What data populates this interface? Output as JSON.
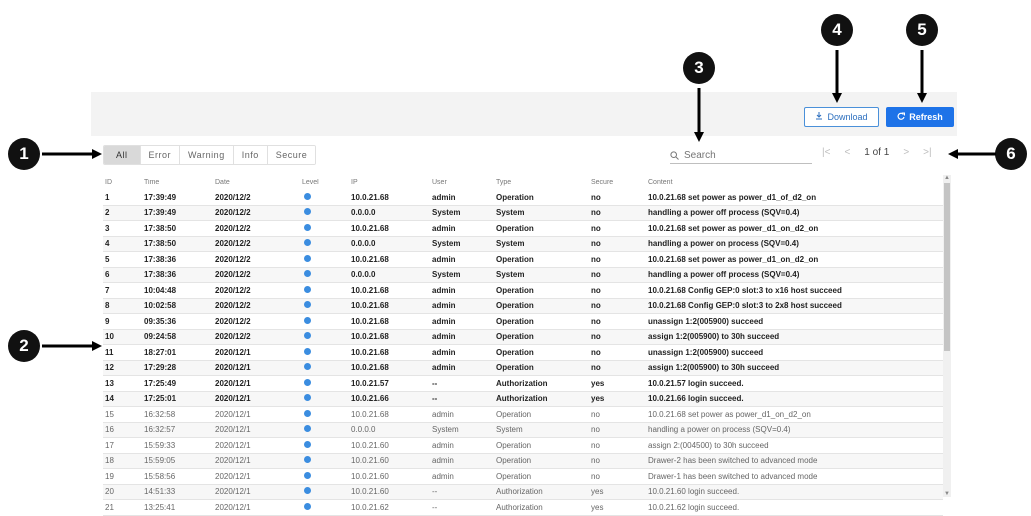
{
  "toolbar": {
    "download_label": "Download",
    "download_icon": "download-icon",
    "refresh_label": "Refresh",
    "refresh_icon": "refresh-icon"
  },
  "filters": [
    "All",
    "Error",
    "Warning",
    "Info",
    "Secure"
  ],
  "active_filter": "All",
  "search": {
    "placeholder": "Search",
    "value": "",
    "icon": "search-icon"
  },
  "pager": {
    "info": "1 of 1",
    "first": "|<",
    "prev": "<",
    "next": ">",
    "last": ">|"
  },
  "columns": [
    "ID",
    "Time",
    "Date",
    "Level",
    "IP",
    "User",
    "Type",
    "Secure",
    "Content"
  ],
  "rows": [
    {
      "id": "1",
      "time": "17:39:49",
      "date": "2020/12/2",
      "ip": "10.0.21.68",
      "user": "admin",
      "type": "Operation",
      "secure": "no",
      "content": "10.0.21.68 set power as power_d1_of_d2_on",
      "style": "bold"
    },
    {
      "id": "2",
      "time": "17:39:49",
      "date": "2020/12/2",
      "ip": "0.0.0.0",
      "user": "System",
      "type": "System",
      "secure": "no",
      "content": "handling a power off process (SQV=0.4)",
      "style": "bold"
    },
    {
      "id": "3",
      "time": "17:38:50",
      "date": "2020/12/2",
      "ip": "10.0.21.68",
      "user": "admin",
      "type": "Operation",
      "secure": "no",
      "content": "10.0.21.68 set power as power_d1_on_d2_on",
      "style": "bold"
    },
    {
      "id": "4",
      "time": "17:38:50",
      "date": "2020/12/2",
      "ip": "0.0.0.0",
      "user": "System",
      "type": "System",
      "secure": "no",
      "content": "handling a power on process (SQV=0.4)",
      "style": "bold"
    },
    {
      "id": "5",
      "time": "17:38:36",
      "date": "2020/12/2",
      "ip": "10.0.21.68",
      "user": "admin",
      "type": "Operation",
      "secure": "no",
      "content": "10.0.21.68 set power as power_d1_on_d2_on",
      "style": "bold"
    },
    {
      "id": "6",
      "time": "17:38:36",
      "date": "2020/12/2",
      "ip": "0.0.0.0",
      "user": "System",
      "type": "System",
      "secure": "no",
      "content": "handling a power off process (SQV=0.4)",
      "style": "bold"
    },
    {
      "id": "7",
      "time": "10:04:48",
      "date": "2020/12/2",
      "ip": "10.0.21.68",
      "user": "admin",
      "type": "Operation",
      "secure": "no",
      "content": "10.0.21.68 Config GEP:0 slot:3 to x16 host succeed",
      "style": "bold"
    },
    {
      "id": "8",
      "time": "10:02:58",
      "date": "2020/12/2",
      "ip": "10.0.21.68",
      "user": "admin",
      "type": "Operation",
      "secure": "no",
      "content": "10.0.21.68 Config GEP:0 slot:3 to 2x8 host succeed",
      "style": "bold"
    },
    {
      "id": "9",
      "time": "09:35:36",
      "date": "2020/12/2",
      "ip": "10.0.21.68",
      "user": "admin",
      "type": "Operation",
      "secure": "no",
      "content": "unassign 1:2(005900) succeed",
      "style": "bold"
    },
    {
      "id": "10",
      "time": "09:24:58",
      "date": "2020/12/2",
      "ip": "10.0.21.68",
      "user": "admin",
      "type": "Operation",
      "secure": "no",
      "content": "assign 1:2(005900) to 30h succeed",
      "style": "bold"
    },
    {
      "id": "11",
      "time": "18:27:01",
      "date": "2020/12/1",
      "ip": "10.0.21.68",
      "user": "admin",
      "type": "Operation",
      "secure": "no",
      "content": "unassign 1:2(005900) succeed",
      "style": "bold"
    },
    {
      "id": "12",
      "time": "17:29:28",
      "date": "2020/12/1",
      "ip": "10.0.21.68",
      "user": "admin",
      "type": "Operation",
      "secure": "no",
      "content": "assign 1:2(005900) to 30h succeed",
      "style": "bold"
    },
    {
      "id": "13",
      "time": "17:25:49",
      "date": "2020/12/1",
      "ip": "10.0.21.57",
      "user": "--",
      "type": "Authorization",
      "secure": "yes",
      "content": "10.0.21.57 login succeed.",
      "style": "bold"
    },
    {
      "id": "14",
      "time": "17:25:01",
      "date": "2020/12/1",
      "ip": "10.0.21.66",
      "user": "--",
      "type": "Authorization",
      "secure": "yes",
      "content": "10.0.21.66 login succeed.",
      "style": "bold"
    },
    {
      "id": "15",
      "time": "16:32:58",
      "date": "2020/12/1",
      "ip": "10.0.21.68",
      "user": "admin",
      "type": "Operation",
      "secure": "no",
      "content": "10.0.21.68 set power as power_d1_on_d2_on",
      "style": "light"
    },
    {
      "id": "16",
      "time": "16:32:57",
      "date": "2020/12/1",
      "ip": "0.0.0.0",
      "user": "System",
      "type": "System",
      "secure": "no",
      "content": "handling a power on process (SQV=0.4)",
      "style": "light"
    },
    {
      "id": "17",
      "time": "15:59:33",
      "date": "2020/12/1",
      "ip": "10.0.21.60",
      "user": "admin",
      "type": "Operation",
      "secure": "no",
      "content": "assign 2:(004500) to 30h succeed",
      "style": "light"
    },
    {
      "id": "18",
      "time": "15:59:05",
      "date": "2020/12/1",
      "ip": "10.0.21.60",
      "user": "admin",
      "type": "Operation",
      "secure": "no",
      "content": "Drawer-2 has been switched to advanced mode",
      "style": "light"
    },
    {
      "id": "19",
      "time": "15:58:56",
      "date": "2020/12/1",
      "ip": "10.0.21.60",
      "user": "admin",
      "type": "Operation",
      "secure": "no",
      "content": "Drawer-1 has been switched to advanced mode",
      "style": "light"
    },
    {
      "id": "20",
      "time": "14:51:33",
      "date": "2020/12/1",
      "ip": "10.0.21.60",
      "user": "--",
      "type": "Authorization",
      "secure": "yes",
      "content": "10.0.21.60 login succeed.",
      "style": "light"
    },
    {
      "id": "21",
      "time": "13:25:41",
      "date": "2020/12/1",
      "ip": "10.0.21.62",
      "user": "--",
      "type": "Authorization",
      "secure": "yes",
      "content": "10.0.21.62 login succeed.",
      "style": "light"
    }
  ],
  "level_color": "#3b8de0",
  "accent_color": "#1e73e8",
  "callouts": [
    "1",
    "2",
    "3",
    "4",
    "5",
    "6"
  ]
}
